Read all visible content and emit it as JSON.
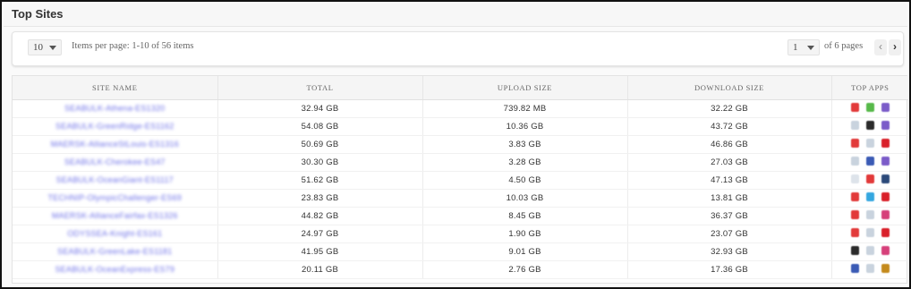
{
  "header": {
    "title": "Top Sites"
  },
  "pagination": {
    "per_page": "10",
    "items_text": "Items per page: 1-10 of 56 items",
    "current_page": "1",
    "of_pages_text": "of 6 pages",
    "prev_icon": "‹",
    "next_icon": "›"
  },
  "table": {
    "columns": [
      "SITE NAME",
      "TOTAL",
      "UPLOAD SIZE",
      "DOWNLOAD SIZE",
      "TOP APPS"
    ],
    "rows": [
      {
        "site": "SEABULK-Athena-ES1320",
        "total": "32.94 GB",
        "upload": "739.82 MB",
        "download": "32.22 GB",
        "apps": [
          {
            "icon": "youtube-icon",
            "color": "#e23a3a"
          },
          {
            "icon": "green-app-icon",
            "color": "#57b94a"
          },
          {
            "icon": "purple-app-icon",
            "color": "#7b5cc9"
          }
        ]
      },
      {
        "site": "SEABULK-GreenRidge-ES1162",
        "total": "54.08 GB",
        "upload": "10.36 GB",
        "download": "43.72 GB",
        "apps": [
          {
            "icon": "browser-icon",
            "color": "#c9d3de"
          },
          {
            "icon": "dark-app-icon",
            "color": "#2b2b2b"
          },
          {
            "icon": "purple-app-icon",
            "color": "#7b5cc9"
          }
        ]
      },
      {
        "site": "MAERSK-AllianceStLouis-ES1316",
        "total": "50.69 GB",
        "upload": "3.83 GB",
        "download": "46.86 GB",
        "apps": [
          {
            "icon": "youtube-icon",
            "color": "#e23a3a"
          },
          {
            "icon": "browser-icon",
            "color": "#c9d3de"
          },
          {
            "icon": "red-app-icon",
            "color": "#d9202a"
          }
        ]
      },
      {
        "site": "SEABULK-Cherokee-ES47",
        "total": "30.30 GB",
        "upload": "3.28 GB",
        "download": "27.03 GB",
        "apps": [
          {
            "icon": "browser-icon",
            "color": "#c9d3de"
          },
          {
            "icon": "facebook-icon",
            "color": "#3b5bb5"
          },
          {
            "icon": "purple-app-icon",
            "color": "#7b5cc9"
          }
        ]
      },
      {
        "site": "SEABULK-OceanGiant-ES1117",
        "total": "51.62 GB",
        "upload": "4.50 GB",
        "download": "47.13 GB",
        "apps": [
          {
            "icon": "light-app-icon",
            "color": "#dde3ea"
          },
          {
            "icon": "youtube-icon",
            "color": "#e23a3a"
          },
          {
            "icon": "navy-app-icon",
            "color": "#2c4a7a"
          }
        ]
      },
      {
        "site": "TECHNIP-OlympicChallenger-ES69",
        "total": "23.83 GB",
        "upload": "10.03 GB",
        "download": "13.81 GB",
        "apps": [
          {
            "icon": "youtube-icon",
            "color": "#e23a3a"
          },
          {
            "icon": "skype-icon",
            "color": "#35a7e0"
          },
          {
            "icon": "red-app-icon",
            "color": "#d9202a"
          }
        ]
      },
      {
        "site": "MAERSK-AllianceFairfax-ES1326",
        "total": "44.82 GB",
        "upload": "8.45 GB",
        "download": "36.37 GB",
        "apps": [
          {
            "icon": "youtube-icon",
            "color": "#e23a3a"
          },
          {
            "icon": "browser-icon",
            "color": "#c9d3de"
          },
          {
            "icon": "instagram-icon",
            "color": "#d6407a"
          }
        ]
      },
      {
        "site": "ODYSSEA-Knight-ES161",
        "total": "24.97 GB",
        "upload": "1.90 GB",
        "download": "23.07 GB",
        "apps": [
          {
            "icon": "youtube-icon",
            "color": "#e23a3a"
          },
          {
            "icon": "browser-icon",
            "color": "#c9d3de"
          },
          {
            "icon": "red-app-icon",
            "color": "#d9202a"
          }
        ]
      },
      {
        "site": "SEABULK-GreenLake-ES1181",
        "total": "41.95 GB",
        "upload": "9.01 GB",
        "download": "32.93 GB",
        "apps": [
          {
            "icon": "dark-app-icon",
            "color": "#2b2b2b"
          },
          {
            "icon": "browser-icon",
            "color": "#c9d3de"
          },
          {
            "icon": "instagram-icon",
            "color": "#d6407a"
          }
        ]
      },
      {
        "site": "SEABULK-OceanExpress-ES79",
        "total": "20.11 GB",
        "upload": "2.76 GB",
        "download": "17.36 GB",
        "apps": [
          {
            "icon": "facebook-icon",
            "color": "#3b5bb5"
          },
          {
            "icon": "browser-icon",
            "color": "#c9d3de"
          },
          {
            "icon": "amber-app-icon",
            "color": "#c48a1c"
          }
        ]
      }
    ]
  }
}
